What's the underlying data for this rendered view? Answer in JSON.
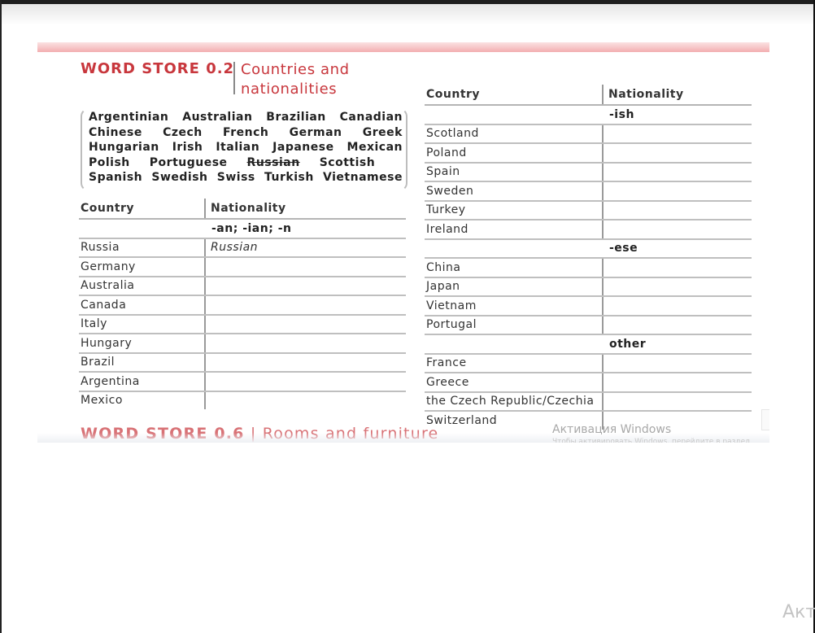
{
  "word_store": {
    "title": "WORD STORE 0.2",
    "subtitle": "Countries and nationalities",
    "word_bank": [
      [
        "Argentinian",
        "Australian",
        "Brazilian",
        "Canadian"
      ],
      [
        "Chinese",
        "Czech",
        "French",
        "German",
        "Greek"
      ],
      [
        "Hungarian",
        "Irish",
        "Italian",
        "Japanese",
        "Mexican"
      ],
      [
        "Polish",
        "Portuguese",
        "Russian",
        "Scottish"
      ],
      [
        "Spanish",
        "Swedish",
        "Swiss",
        "Turkish",
        "Vietnamese"
      ]
    ],
    "crossed_out": "Russian"
  },
  "left_table": {
    "headers": {
      "country": "Country",
      "nationality": "Nationality"
    },
    "group_label": "-an; -ian; -n",
    "rows": [
      {
        "country": "Russia",
        "nationality": "Russian"
      },
      {
        "country": "Germany",
        "nationality": ""
      },
      {
        "country": "Australia",
        "nationality": ""
      },
      {
        "country": "Canada",
        "nationality": ""
      },
      {
        "country": "Italy",
        "nationality": ""
      },
      {
        "country": "Hungary",
        "nationality": ""
      },
      {
        "country": "Brazil",
        "nationality": ""
      },
      {
        "country": "Argentina",
        "nationality": ""
      },
      {
        "country": "Mexico",
        "nationality": ""
      }
    ]
  },
  "right_table": {
    "headers": {
      "country": "Country",
      "nationality": "Nationality"
    },
    "groups": [
      {
        "label": "-ish",
        "rows": [
          "Scotland",
          "Poland",
          "Spain",
          "Sweden",
          "Turkey",
          "Ireland"
        ]
      },
      {
        "label": "-ese",
        "rows": [
          "China",
          "Japan",
          "Vietnam",
          "Portugal"
        ]
      },
      {
        "label": "other",
        "rows": [
          "France",
          "Greece",
          "the Czech Republic/Czechia",
          "Switzerland"
        ]
      }
    ]
  },
  "next_section": {
    "title": "WORD STORE 0.6",
    "subtitle": "Rooms and furniture"
  },
  "watermark": {
    "title": "Активация Windows",
    "subtitle": "Чтобы активировать Windows, перейдите в раздел",
    "corner": "Акт"
  },
  "colors": {
    "accent_red": "#c8373d",
    "answer_blue": "#3a6fa6"
  }
}
